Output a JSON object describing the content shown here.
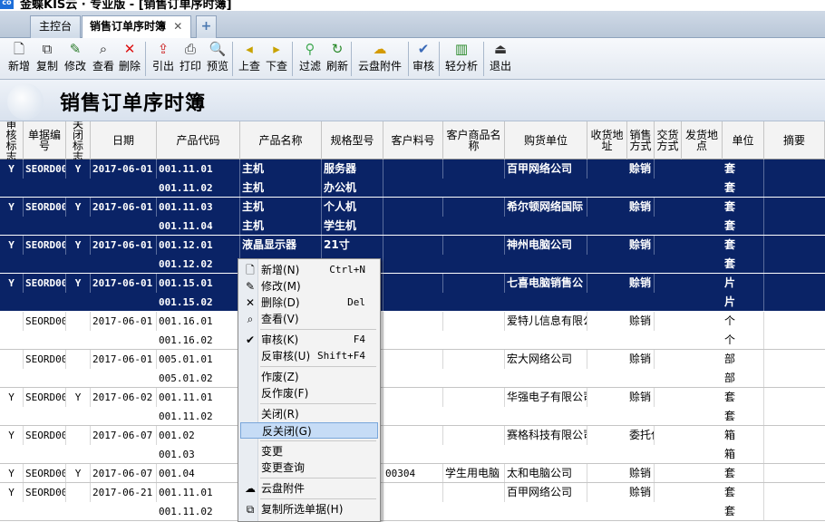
{
  "window": {
    "title": "金蝶KIS云 · 专业版 - [销售订单序时簿]",
    "logo_text": "co"
  },
  "tabs": [
    {
      "label": "主控台"
    },
    {
      "label": "销售订单序时簿",
      "close": "✕"
    },
    {
      "label": "+"
    }
  ],
  "toolbar": [
    {
      "label": "新增",
      "icon": "new-doc-icon",
      "glyph": "🗋"
    },
    {
      "label": "复制",
      "icon": "copy-icon",
      "glyph": "⧉"
    },
    {
      "label": "修改",
      "icon": "edit-icon",
      "glyph": "✎"
    },
    {
      "label": "查看",
      "icon": "binoculars-icon",
      "glyph": "⌕"
    },
    {
      "label": "删除",
      "icon": "delete-icon",
      "glyph": "✕"
    },
    {
      "label": "引出",
      "icon": "export-icon",
      "glyph": "⇪"
    },
    {
      "label": "打印",
      "icon": "print-icon",
      "glyph": "⎙"
    },
    {
      "label": "预览",
      "icon": "preview-icon",
      "glyph": "🔍"
    },
    {
      "label": "上查",
      "icon": "trace-up-icon",
      "glyph": "◂"
    },
    {
      "label": "下查",
      "icon": "trace-down-icon",
      "glyph": "▸"
    },
    {
      "label": "过滤",
      "icon": "filter-icon",
      "glyph": "⚲"
    },
    {
      "label": "刷新",
      "icon": "refresh-icon",
      "glyph": "↻"
    },
    {
      "label": "云盘附件",
      "icon": "cloud-attach-icon",
      "glyph": "☁"
    },
    {
      "label": "审核",
      "icon": "audit-icon",
      "glyph": "✔"
    },
    {
      "label": "轻分析",
      "icon": "analysis-icon",
      "glyph": "▥"
    },
    {
      "label": "退出",
      "icon": "exit-icon",
      "glyph": "⏏"
    }
  ],
  "page_title": "销售订单序时簿",
  "columns": [
    "审核标志",
    "单据编号",
    "关闭标志",
    "日期",
    "产品代码",
    "产品名称",
    "规格型号",
    "客户料号",
    "客户商品名称",
    "购货单位",
    "收货地址",
    "销售方式",
    "交货方式",
    "发货地点",
    "单位",
    "摘要"
  ],
  "orders": [
    {
      "selected": true,
      "audit": "Y",
      "bill_no": "SEORD00",
      "closed": "Y",
      "date": "2017-06-01",
      "lines": [
        {
          "code": "001.11.01",
          "name": "主机",
          "spec": "服务器",
          "unit": "套"
        },
        {
          "code": "001.11.02",
          "name": "主机",
          "spec": "办公机",
          "unit": "套"
        }
      ],
      "customer": "百甲网络公司",
      "sale_mode": "赊销",
      "cust_part": "",
      "cust_item": ""
    },
    {
      "selected": true,
      "audit": "Y",
      "bill_no": "SEORD00",
      "closed": "Y",
      "date": "2017-06-01",
      "lines": [
        {
          "code": "001.11.03",
          "name": "主机",
          "spec": "个人机",
          "unit": "套"
        },
        {
          "code": "001.11.04",
          "name": "主机",
          "spec": "学生机",
          "unit": "套"
        }
      ],
      "customer": "希尔顿网络国际",
      "sale_mode": "赊销",
      "cust_part": "",
      "cust_item": ""
    },
    {
      "selected": true,
      "audit": "Y",
      "bill_no": "SEORD00",
      "closed": "Y",
      "date": "2017-06-01",
      "lines": [
        {
          "code": "001.12.01",
          "name": "液晶显示器",
          "spec": "21寸",
          "unit": "套"
        },
        {
          "code": "001.12.02",
          "name": "",
          "spec": "",
          "unit": "套"
        }
      ],
      "customer": "神州电脑公司",
      "sale_mode": "赊销",
      "cust_part": "",
      "cust_item": ""
    },
    {
      "selected": true,
      "audit": "Y",
      "bill_no": "SEORD00",
      "closed": "Y",
      "date": "2017-06-01",
      "lines": [
        {
          "code": "001.15.01",
          "name": "",
          "spec": "",
          "unit": "片"
        },
        {
          "code": "001.15.02",
          "name": "",
          "spec": "",
          "unit": "片"
        }
      ],
      "customer": "七喜电脑销售公",
      "sale_mode": "赊销",
      "cust_part": "",
      "cust_item": ""
    },
    {
      "selected": false,
      "audit": "",
      "bill_no": "SEORD00",
      "closed": "",
      "date": "2017-06-01",
      "lines": [
        {
          "code": "001.16.01",
          "name": "",
          "spec": "",
          "unit": "个"
        },
        {
          "code": "001.16.02",
          "name": "",
          "spec": "",
          "unit": "个"
        }
      ],
      "customer": "爱特儿信息有限公",
      "sale_mode": "赊销",
      "cust_part": "",
      "cust_item": ""
    },
    {
      "selected": false,
      "audit": "",
      "bill_no": "SEORD00",
      "closed": "",
      "date": "2017-06-01",
      "lines": [
        {
          "code": "005.01.01",
          "name": "",
          "spec": "",
          "unit": "部"
        },
        {
          "code": "005.01.02",
          "name": "",
          "spec": "",
          "unit": "部"
        }
      ],
      "customer": "宏大网络公司",
      "sale_mode": "赊销",
      "cust_part": "",
      "cust_item": ""
    },
    {
      "selected": false,
      "audit": "Y",
      "bill_no": "SEORD00",
      "closed": "Y",
      "date": "2017-06-02",
      "lines": [
        {
          "code": "001.11.01",
          "name": "",
          "spec": "",
          "unit": "套"
        },
        {
          "code": "001.11.02",
          "name": "",
          "spec": "",
          "unit": "套"
        }
      ],
      "customer": "华强电子有限公司",
      "sale_mode": "赊销",
      "cust_part": "",
      "cust_item": ""
    },
    {
      "selected": false,
      "audit": "Y",
      "bill_no": "SEORD00",
      "closed": "",
      "date": "2017-06-07",
      "lines": [
        {
          "code": "001.02",
          "name": "",
          "spec": "",
          "unit": "箱"
        },
        {
          "code": "001.03",
          "name": "",
          "spec": "",
          "unit": "箱"
        }
      ],
      "customer": "赛格科技有限公司",
      "sale_mode": "委托代",
      "cust_part": "",
      "cust_item": ""
    },
    {
      "selected": false,
      "audit": "Y",
      "bill_no": "SEORD00",
      "closed": "Y",
      "date": "2017-06-07",
      "lines": [
        {
          "code": "001.04",
          "name": "",
          "spec": "",
          "unit": "套"
        }
      ],
      "customer": "太和电脑公司",
      "sale_mode": "赊销",
      "cust_part": "00304",
      "cust_item": "学生用电脑"
    },
    {
      "selected": false,
      "audit": "Y",
      "bill_no": "SEORD00",
      "closed": "",
      "date": "2017-06-21",
      "lines": [
        {
          "code": "001.11.01",
          "name": "",
          "spec": "",
          "unit": "套"
        },
        {
          "code": "001.11.02",
          "name": "",
          "spec": "",
          "unit": "套"
        }
      ],
      "customer": "百甲网络公司",
      "sale_mode": "赊销",
      "cust_part": "",
      "cust_item": ""
    }
  ],
  "context_menu": [
    {
      "label": "新增(N)",
      "shortcut": "Ctrl+N",
      "glyph": "🗋",
      "icon": "new-doc-icon"
    },
    {
      "label": "修改(M)",
      "shortcut": "",
      "glyph": "✎",
      "icon": "edit-icon"
    },
    {
      "label": "删除(D)",
      "shortcut": "Del",
      "glyph": "✕",
      "icon": "delete-icon"
    },
    {
      "label": "查看(V)",
      "shortcut": "",
      "glyph": "⌕",
      "icon": "binoculars-icon"
    },
    {
      "sep": true
    },
    {
      "label": "审核(K)",
      "shortcut": "F4",
      "glyph": "✔",
      "icon": "audit-icon"
    },
    {
      "label": "反审核(U)",
      "shortcut": "Shift+F4",
      "glyph": "",
      "icon": ""
    },
    {
      "sep": true
    },
    {
      "label": "作废(Z)",
      "shortcut": "",
      "glyph": "",
      "icon": ""
    },
    {
      "label": "反作废(F)",
      "shortcut": "",
      "glyph": "",
      "icon": ""
    },
    {
      "sep": true
    },
    {
      "label": "关闭(R)",
      "shortcut": "",
      "glyph": "",
      "icon": ""
    },
    {
      "label": "反关闭(G)",
      "shortcut": "",
      "glyph": "",
      "icon": "",
      "highlight": true
    },
    {
      "sep": true
    },
    {
      "label": "变更",
      "shortcut": "",
      "glyph": "",
      "icon": ""
    },
    {
      "label": "变更查询",
      "shortcut": "",
      "glyph": "",
      "icon": ""
    },
    {
      "sep": true
    },
    {
      "label": "云盘附件",
      "shortcut": "",
      "glyph": "☁",
      "icon": "cloud-attach-icon"
    },
    {
      "sep": true
    },
    {
      "label": "复制所选单据(H)",
      "shortcut": "",
      "glyph": "⧉",
      "icon": "copy-icon"
    }
  ],
  "colors": {
    "selected_row": "#0a2366",
    "menu_highlight": "#c6dcf6"
  }
}
